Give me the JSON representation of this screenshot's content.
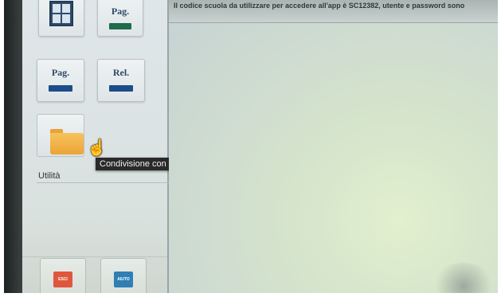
{
  "sidebar": {
    "tiles": [
      {
        "label": ""
      },
      {
        "label": "Pag."
      },
      {
        "label": "Pag."
      },
      {
        "label": "Rel."
      }
    ],
    "tooltip": "Condivisione con i Docenti",
    "section_label": "Utilità",
    "exit_button": "ESCI",
    "help_button": "AIUTO"
  },
  "banner": {
    "text": "Il codice scuola da utilizzare per accedere all'app è SC12382, utente e password sono"
  },
  "colors": {
    "tile_bar_green": "#1f6b4a",
    "tile_bar_blue": "#1d4c8a",
    "exit_red": "#e0563c",
    "help_blue": "#2f7fb5"
  }
}
